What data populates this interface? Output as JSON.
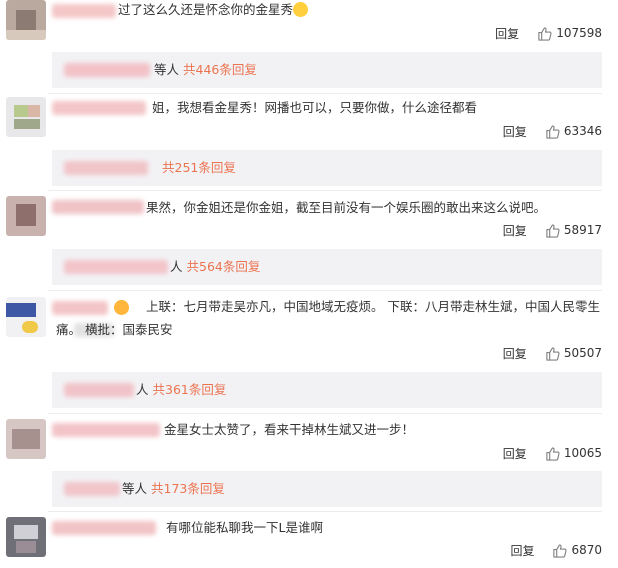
{
  "comments": [
    {
      "text": "过了这么久还是怀念你的金星秀",
      "emoji": "laughing-tears-emoji",
      "reply_label": "回复",
      "likes": "107598",
      "sub": {
        "people": "等人",
        "count": "共446条回复"
      }
    },
    {
      "text": "姐，我想看金星秀！网播也可以，只要你做，什么途径都看",
      "reply_label": "回复",
      "likes": "63346",
      "sub": {
        "people": "",
        "count": "共251条回复"
      }
    },
    {
      "text": "果然，你金姐还是你金姐，截至目前没有一个娱乐圈的敢出来这么说吧。",
      "reply_label": "回复",
      "likes": "58917",
      "sub": {
        "people": "人",
        "count": "共564条回复"
      }
    },
    {
      "text_line1": "上联：七月带走吴亦凡，中国地域无疫烦。 下联：八月带走林生斌，中国人民零生",
      "text_line2": "痛。 横批：国泰民安",
      "reply_label": "回复",
      "likes": "50507",
      "sub": {
        "people": "人",
        "count": "共361条回复"
      }
    },
    {
      "text": "金星女士太赞了，看来干掉林生斌又进一步！",
      "reply_label": "回复",
      "likes": "10065",
      "sub": {
        "people": "等人",
        "count": "共173条回复"
      }
    },
    {
      "text": "有哪位能私聊我一下L是谁啊",
      "reply_label": "回复",
      "likes": "6870"
    }
  ],
  "colors": {
    "reply_count": "#eb7350",
    "subbox_bg": "#f2f2f5",
    "text": "#333333"
  }
}
